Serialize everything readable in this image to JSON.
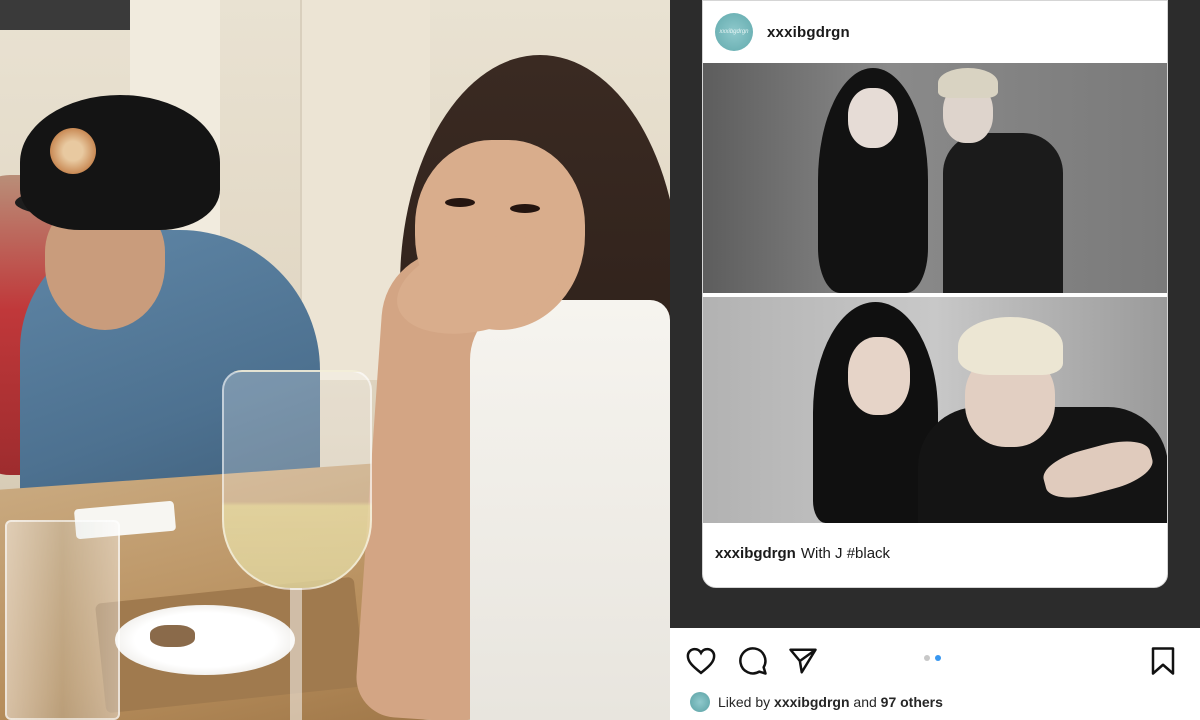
{
  "post": {
    "username": "xxxibgdrgn",
    "avatar_text": "xxxibgdrgn",
    "caption_user": "xxxibgdrgn",
    "caption_text": "With J #black"
  },
  "actions": {
    "like_icon": "heart-icon",
    "comment_icon": "comment-icon",
    "share_icon": "paper-plane-icon",
    "save_icon": "bookmark-icon",
    "carousel_total": 2,
    "carousel_active": 2
  },
  "likes": {
    "prefix": "Liked by",
    "liker": "xxxibgdrgn",
    "joiner": "and",
    "others": "97 others"
  },
  "colors": {
    "accent": "#3897f0",
    "avatar": "#6fb3b6",
    "frame": "#2c2c2c"
  }
}
